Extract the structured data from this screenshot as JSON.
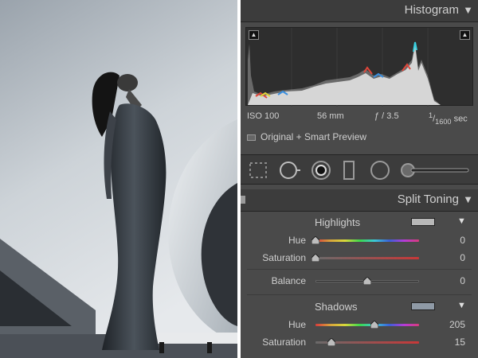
{
  "histogram": {
    "title": "Histogram",
    "exif": {
      "iso": "ISO 100",
      "focal": "56 mm",
      "aperture": "ƒ / 3.5",
      "shutter_num": "1",
      "shutter_den": "1600",
      "shutter_unit": "sec"
    },
    "preview_label": "Original + Smart Preview"
  },
  "tools": [
    "crop-overlay-tool",
    "spot-removal-tool",
    "red-eye-tool",
    "graduated-filter-tool",
    "radial-filter-tool",
    "adjustment-brush-tool"
  ],
  "split_toning": {
    "title": "Split Toning",
    "highlights": {
      "label": "Highlights",
      "swatch_color": "#b8b8b8",
      "hue_label": "Hue",
      "hue_value": "0",
      "hue_fraction": 0.0,
      "sat_label": "Saturation",
      "sat_value": "0",
      "sat_fraction": 0.0
    },
    "balance": {
      "label": "Balance",
      "value": "0",
      "fraction": 0.5
    },
    "shadows": {
      "label": "Shadows",
      "swatch_color": "#8f9aa6",
      "hue_label": "Hue",
      "hue_value": "205",
      "hue_fraction": 0.57,
      "sat_label": "Saturation",
      "sat_value": "15",
      "sat_fraction": 0.15
    }
  },
  "colors": {
    "panel_bg": "#4a4a4a",
    "header_bg": "#3c3c3c",
    "text": "#cfcfcf"
  }
}
